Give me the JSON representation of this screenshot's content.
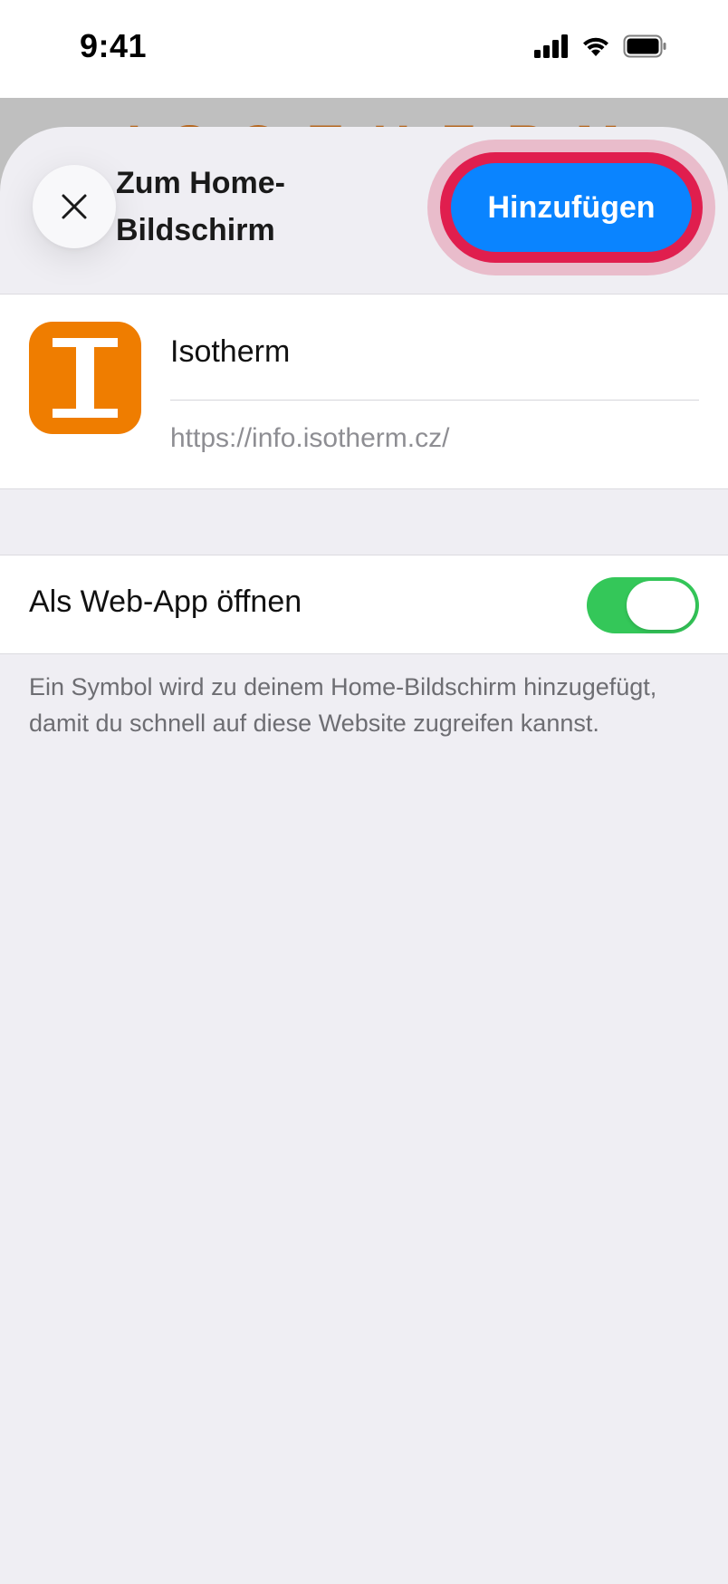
{
  "status_bar": {
    "time": "9:41",
    "icons": [
      "signal-icon",
      "wifi-icon",
      "battery-icon"
    ]
  },
  "background_page": {
    "peek_text": "ISOTHERM"
  },
  "sheet": {
    "title": "Zum Home-Bildschirm",
    "close_icon": "close-icon",
    "add_label": "Hinzufügen"
  },
  "app": {
    "icon_letter": "I",
    "icon_color": "#ef7d00",
    "name": "Isotherm",
    "url": "https://info.isotherm.cz/"
  },
  "web_app": {
    "label": "Als Web-App öffnen",
    "enabled": true
  },
  "footer": {
    "text": "Ein Symbol wird zu deinem Home-Bildschirm hinzugefügt, damit du schnell auf diese Website zugreifen kannst."
  },
  "colors": {
    "accent": "#0a84ff",
    "highlight": "#e01e4e",
    "toggle_on": "#34c759",
    "sheet_bg": "#efeef3"
  }
}
